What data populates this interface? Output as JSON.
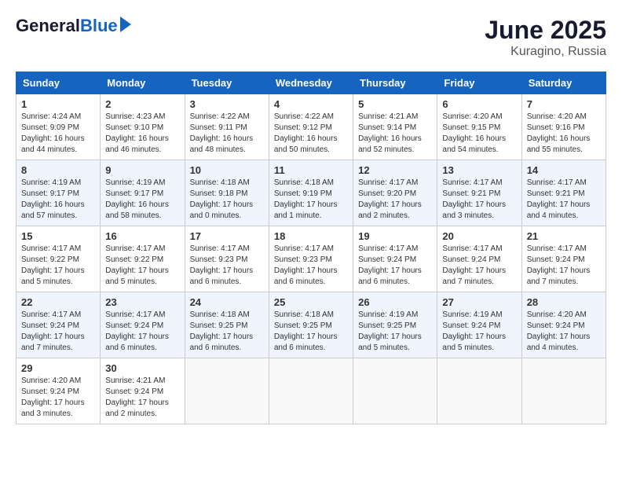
{
  "header": {
    "logo_general": "General",
    "logo_blue": "Blue",
    "month_year": "June 2025",
    "location": "Kuragino, Russia"
  },
  "days_of_week": [
    "Sunday",
    "Monday",
    "Tuesday",
    "Wednesday",
    "Thursday",
    "Friday",
    "Saturday"
  ],
  "weeks": [
    [
      {
        "day": "1",
        "sunrise": "4:24 AM",
        "sunset": "9:09 PM",
        "daylight": "16 hours and 44 minutes."
      },
      {
        "day": "2",
        "sunrise": "4:23 AM",
        "sunset": "9:10 PM",
        "daylight": "16 hours and 46 minutes."
      },
      {
        "day": "3",
        "sunrise": "4:22 AM",
        "sunset": "9:11 PM",
        "daylight": "16 hours and 48 minutes."
      },
      {
        "day": "4",
        "sunrise": "4:22 AM",
        "sunset": "9:12 PM",
        "daylight": "16 hours and 50 minutes."
      },
      {
        "day": "5",
        "sunrise": "4:21 AM",
        "sunset": "9:14 PM",
        "daylight": "16 hours and 52 minutes."
      },
      {
        "day": "6",
        "sunrise": "4:20 AM",
        "sunset": "9:15 PM",
        "daylight": "16 hours and 54 minutes."
      },
      {
        "day": "7",
        "sunrise": "4:20 AM",
        "sunset": "9:16 PM",
        "daylight": "16 hours and 55 minutes."
      }
    ],
    [
      {
        "day": "8",
        "sunrise": "4:19 AM",
        "sunset": "9:17 PM",
        "daylight": "16 hours and 57 minutes."
      },
      {
        "day": "9",
        "sunrise": "4:19 AM",
        "sunset": "9:17 PM",
        "daylight": "16 hours and 58 minutes."
      },
      {
        "day": "10",
        "sunrise": "4:18 AM",
        "sunset": "9:18 PM",
        "daylight": "17 hours and 0 minutes."
      },
      {
        "day": "11",
        "sunrise": "4:18 AM",
        "sunset": "9:19 PM",
        "daylight": "17 hours and 1 minute."
      },
      {
        "day": "12",
        "sunrise": "4:17 AM",
        "sunset": "9:20 PM",
        "daylight": "17 hours and 2 minutes."
      },
      {
        "day": "13",
        "sunrise": "4:17 AM",
        "sunset": "9:21 PM",
        "daylight": "17 hours and 3 minutes."
      },
      {
        "day": "14",
        "sunrise": "4:17 AM",
        "sunset": "9:21 PM",
        "daylight": "17 hours and 4 minutes."
      }
    ],
    [
      {
        "day": "15",
        "sunrise": "4:17 AM",
        "sunset": "9:22 PM",
        "daylight": "17 hours and 5 minutes."
      },
      {
        "day": "16",
        "sunrise": "4:17 AM",
        "sunset": "9:22 PM",
        "daylight": "17 hours and 5 minutes."
      },
      {
        "day": "17",
        "sunrise": "4:17 AM",
        "sunset": "9:23 PM",
        "daylight": "17 hours and 6 minutes."
      },
      {
        "day": "18",
        "sunrise": "4:17 AM",
        "sunset": "9:23 PM",
        "daylight": "17 hours and 6 minutes."
      },
      {
        "day": "19",
        "sunrise": "4:17 AM",
        "sunset": "9:24 PM",
        "daylight": "17 hours and 6 minutes."
      },
      {
        "day": "20",
        "sunrise": "4:17 AM",
        "sunset": "9:24 PM",
        "daylight": "17 hours and 7 minutes."
      },
      {
        "day": "21",
        "sunrise": "4:17 AM",
        "sunset": "9:24 PM",
        "daylight": "17 hours and 7 minutes."
      }
    ],
    [
      {
        "day": "22",
        "sunrise": "4:17 AM",
        "sunset": "9:24 PM",
        "daylight": "17 hours and 7 minutes."
      },
      {
        "day": "23",
        "sunrise": "4:17 AM",
        "sunset": "9:24 PM",
        "daylight": "17 hours and 6 minutes."
      },
      {
        "day": "24",
        "sunrise": "4:18 AM",
        "sunset": "9:25 PM",
        "daylight": "17 hours and 6 minutes."
      },
      {
        "day": "25",
        "sunrise": "4:18 AM",
        "sunset": "9:25 PM",
        "daylight": "17 hours and 6 minutes."
      },
      {
        "day": "26",
        "sunrise": "4:19 AM",
        "sunset": "9:25 PM",
        "daylight": "17 hours and 5 minutes."
      },
      {
        "day": "27",
        "sunrise": "4:19 AM",
        "sunset": "9:24 PM",
        "daylight": "17 hours and 5 minutes."
      },
      {
        "day": "28",
        "sunrise": "4:20 AM",
        "sunset": "9:24 PM",
        "daylight": "17 hours and 4 minutes."
      }
    ],
    [
      {
        "day": "29",
        "sunrise": "4:20 AM",
        "sunset": "9:24 PM",
        "daylight": "17 hours and 3 minutes."
      },
      {
        "day": "30",
        "sunrise": "4:21 AM",
        "sunset": "9:24 PM",
        "daylight": "17 hours and 2 minutes."
      },
      null,
      null,
      null,
      null,
      null
    ]
  ]
}
